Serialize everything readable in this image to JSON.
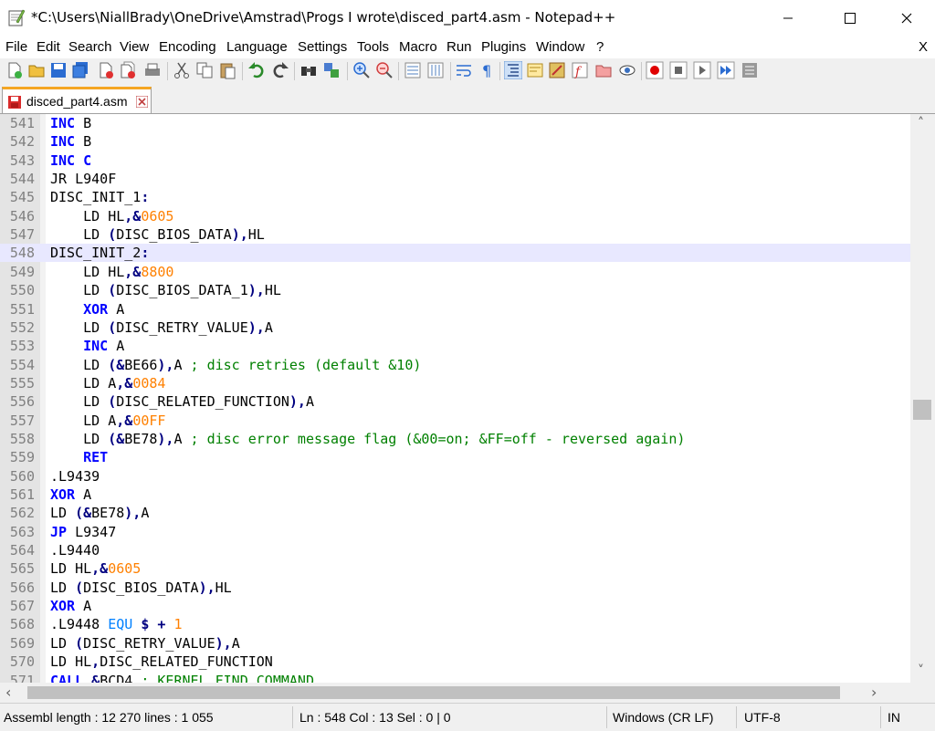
{
  "window": {
    "title": "*C:\\Users\\NiallBrady\\OneDrive\\Amstrad\\Progs I wrote\\disced_part4.asm - Notepad++",
    "minimize_glyph": "—",
    "maximize_glyph": "☐",
    "close_glyph": "✕"
  },
  "menu": {
    "items": [
      "File",
      "Edit",
      "Search",
      "View",
      "Encoding",
      "Language",
      "Settings",
      "Tools",
      "Macro",
      "Run",
      "Plugins",
      "Window",
      "?"
    ],
    "close_doc": "X"
  },
  "toolbar": {
    "icons": [
      "new-file-icon",
      "open-file-icon",
      "save-icon",
      "save-all-icon",
      "close-icon",
      "close-all-icon",
      "print-icon",
      "cut-icon",
      "copy-icon",
      "paste-icon",
      "undo-icon",
      "redo-icon",
      "find-icon",
      "replace-icon",
      "zoom-in-icon",
      "zoom-out-icon",
      "sync-vertical-icon",
      "sync-horizontal-icon",
      "word-wrap-icon",
      "show-all-chars-icon",
      "indent-guide-icon",
      "document-map-icon",
      "function-list-icon",
      "folder-as-workspace-icon",
      "monitoring-icon",
      "record-macro-icon",
      "stop-macro-icon",
      "play-macro-icon",
      "run-macro-multiple-icon",
      "save-macro-icon"
    ]
  },
  "tabs": [
    {
      "label": "disced_part4.asm",
      "modified": true
    }
  ],
  "editor": {
    "current_line": 548,
    "lines": [
      {
        "n": "541",
        "tokens": [
          {
            "t": "INC",
            "c": "kw"
          },
          {
            "t": " B",
            "c": "tx"
          }
        ]
      },
      {
        "n": "542",
        "tokens": [
          {
            "t": "INC",
            "c": "kw"
          },
          {
            "t": " B",
            "c": "tx"
          }
        ]
      },
      {
        "n": "543",
        "tokens": [
          {
            "t": "INC C",
            "c": "kw"
          }
        ]
      },
      {
        "n": "544",
        "tokens": [
          {
            "t": "JR L940F",
            "c": "tx"
          }
        ]
      },
      {
        "n": "545",
        "tokens": [
          {
            "t": "DISC_INIT_1",
            "c": "tx"
          },
          {
            "t": ":",
            "c": "op"
          }
        ]
      },
      {
        "n": "546",
        "tokens": [
          {
            "t": "    LD HL",
            "c": "tx"
          },
          {
            "t": ",&",
            "c": "op"
          },
          {
            "t": "0605",
            "c": "num"
          }
        ]
      },
      {
        "n": "547",
        "tokens": [
          {
            "t": "    LD ",
            "c": "tx"
          },
          {
            "t": "(",
            "c": "op"
          },
          {
            "t": "DISC_BIOS_DATA",
            "c": "tx"
          },
          {
            "t": "),",
            "c": "op"
          },
          {
            "t": "HL",
            "c": "tx"
          }
        ]
      },
      {
        "n": "548",
        "tokens": [
          {
            "t": "DISC_INIT_2",
            "c": "tx"
          },
          {
            "t": ":",
            "c": "op"
          }
        ]
      },
      {
        "n": "549",
        "tokens": [
          {
            "t": "    LD HL",
            "c": "tx"
          },
          {
            "t": ",&",
            "c": "op"
          },
          {
            "t": "8800",
            "c": "num"
          }
        ]
      },
      {
        "n": "550",
        "tokens": [
          {
            "t": "    LD ",
            "c": "tx"
          },
          {
            "t": "(",
            "c": "op"
          },
          {
            "t": "DISC_BIOS_DATA_1",
            "c": "tx"
          },
          {
            "t": "),",
            "c": "op"
          },
          {
            "t": "HL",
            "c": "tx"
          }
        ]
      },
      {
        "n": "551",
        "tokens": [
          {
            "t": "    ",
            "c": "tx"
          },
          {
            "t": "XOR",
            "c": "kw"
          },
          {
            "t": " A",
            "c": "tx"
          }
        ]
      },
      {
        "n": "552",
        "tokens": [
          {
            "t": "    LD ",
            "c": "tx"
          },
          {
            "t": "(",
            "c": "op"
          },
          {
            "t": "DISC_RETRY_VALUE",
            "c": "tx"
          },
          {
            "t": "),",
            "c": "op"
          },
          {
            "t": "A",
            "c": "tx"
          }
        ]
      },
      {
        "n": "553",
        "tokens": [
          {
            "t": "    ",
            "c": "tx"
          },
          {
            "t": "INC",
            "c": "kw"
          },
          {
            "t": " A",
            "c": "tx"
          }
        ]
      },
      {
        "n": "554",
        "tokens": [
          {
            "t": "    LD ",
            "c": "tx"
          },
          {
            "t": "(&",
            "c": "op"
          },
          {
            "t": "BE66",
            "c": "tx"
          },
          {
            "t": "),",
            "c": "op"
          },
          {
            "t": "A ",
            "c": "tx"
          },
          {
            "t": "; disc retries (default &10)",
            "c": "cm"
          }
        ]
      },
      {
        "n": "555",
        "tokens": [
          {
            "t": "    LD A",
            "c": "tx"
          },
          {
            "t": ",&",
            "c": "op"
          },
          {
            "t": "0084",
            "c": "num"
          }
        ]
      },
      {
        "n": "556",
        "tokens": [
          {
            "t": "    LD ",
            "c": "tx"
          },
          {
            "t": "(",
            "c": "op"
          },
          {
            "t": "DISC_RELATED_FUNCTION",
            "c": "tx"
          },
          {
            "t": "),",
            "c": "op"
          },
          {
            "t": "A",
            "c": "tx"
          }
        ]
      },
      {
        "n": "557",
        "tokens": [
          {
            "t": "    LD A",
            "c": "tx"
          },
          {
            "t": ",&",
            "c": "op"
          },
          {
            "t": "00FF",
            "c": "num"
          }
        ]
      },
      {
        "n": "558",
        "tokens": [
          {
            "t": "    LD ",
            "c": "tx"
          },
          {
            "t": "(&",
            "c": "op"
          },
          {
            "t": "BE78",
            "c": "tx"
          },
          {
            "t": "),",
            "c": "op"
          },
          {
            "t": "A ",
            "c": "tx"
          },
          {
            "t": "; disc error message flag (&00=on; &FF=off - reversed again)",
            "c": "cm"
          }
        ]
      },
      {
        "n": "559",
        "tokens": [
          {
            "t": "    ",
            "c": "tx"
          },
          {
            "t": "RET",
            "c": "kw"
          }
        ]
      },
      {
        "n": "560",
        "tokens": [
          {
            "t": ".L9439",
            "c": "tx"
          }
        ]
      },
      {
        "n": "561",
        "tokens": [
          {
            "t": "XOR",
            "c": "kw"
          },
          {
            "t": " A",
            "c": "tx"
          }
        ]
      },
      {
        "n": "562",
        "tokens": [
          {
            "t": "LD ",
            "c": "tx"
          },
          {
            "t": "(&",
            "c": "op"
          },
          {
            "t": "BE78",
            "c": "tx"
          },
          {
            "t": "),",
            "c": "op"
          },
          {
            "t": "A",
            "c": "tx"
          }
        ]
      },
      {
        "n": "563",
        "tokens": [
          {
            "t": "JP",
            "c": "kw"
          },
          {
            "t": " L9347",
            "c": "tx"
          }
        ]
      },
      {
        "n": "564",
        "tokens": [
          {
            "t": ".L9440",
            "c": "tx"
          }
        ]
      },
      {
        "n": "565",
        "tokens": [
          {
            "t": "LD HL",
            "c": "tx"
          },
          {
            "t": ",&",
            "c": "op"
          },
          {
            "t": "0605",
            "c": "num"
          }
        ]
      },
      {
        "n": "566",
        "tokens": [
          {
            "t": "LD ",
            "c": "tx"
          },
          {
            "t": "(",
            "c": "op"
          },
          {
            "t": "DISC_BIOS_DATA",
            "c": "tx"
          },
          {
            "t": "),",
            "c": "op"
          },
          {
            "t": "HL",
            "c": "tx"
          }
        ]
      },
      {
        "n": "567",
        "tokens": [
          {
            "t": "XOR",
            "c": "kw"
          },
          {
            "t": " A",
            "c": "tx"
          }
        ]
      },
      {
        "n": "568",
        "tokens": [
          {
            "t": ".L9448 ",
            "c": "tx"
          },
          {
            "t": "EQU",
            "c": "kw2"
          },
          {
            "t": " ",
            "c": "tx"
          },
          {
            "t": "$ +",
            "c": "op"
          },
          {
            "t": " ",
            "c": "tx"
          },
          {
            "t": "1",
            "c": "num"
          }
        ]
      },
      {
        "n": "569",
        "tokens": [
          {
            "t": "LD ",
            "c": "tx"
          },
          {
            "t": "(",
            "c": "op"
          },
          {
            "t": "DISC_RETRY_VALUE",
            "c": "tx"
          },
          {
            "t": "),",
            "c": "op"
          },
          {
            "t": "A",
            "c": "tx"
          }
        ]
      },
      {
        "n": "570",
        "tokens": [
          {
            "t": "LD HL",
            "c": "tx"
          },
          {
            "t": ",",
            "c": "op"
          },
          {
            "t": "DISC_RELATED_FUNCTION",
            "c": "tx"
          }
        ]
      },
      {
        "n": "571",
        "tokens": [
          {
            "t": "CALL",
            "c": "kw"
          },
          {
            "t": " &",
            "c": "op"
          },
          {
            "t": "BCD4 ",
            "c": "tx"
          },
          {
            "t": "; KERNEL_FIND_COMMAND",
            "c": "cm"
          }
        ]
      }
    ]
  },
  "scrollbars": {
    "up_glyph": "˄",
    "down_glyph": "˅",
    "left_glyph": "‹",
    "right_glyph": "›"
  },
  "status": {
    "file_info": "Assembl length : 12 270    lines : 1 055",
    "position": "Ln : 548    Col : 13    Sel : 0 | 0",
    "eol": "Windows (CR LF)",
    "encoding": "UTF-8",
    "mode": "IN"
  },
  "colors": {
    "keyword": "#0000ff",
    "number": "#ff8000",
    "comment": "#008000",
    "operator": "#000080",
    "current_line": "#e8e8ff",
    "tab_accent": "#f5a623"
  }
}
